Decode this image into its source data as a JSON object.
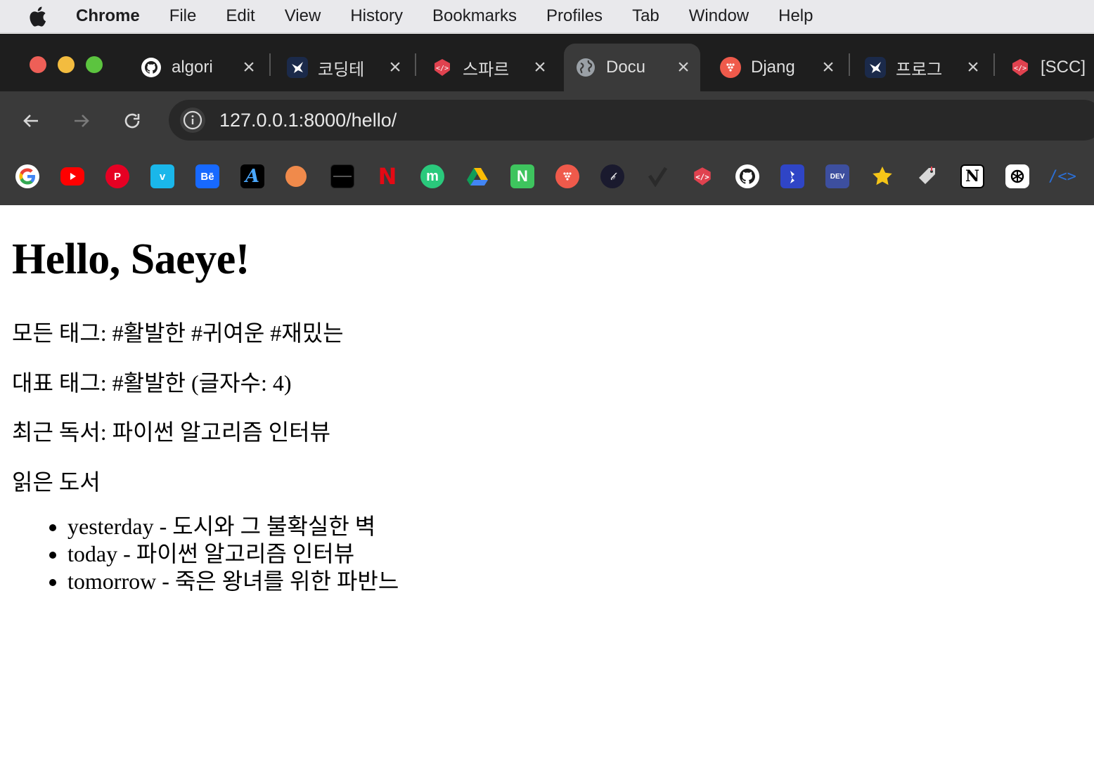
{
  "menubar": {
    "app": "Chrome",
    "items": [
      "File",
      "Edit",
      "View",
      "History",
      "Bookmarks",
      "Profiles",
      "Tab",
      "Window",
      "Help"
    ]
  },
  "tabs": [
    {
      "title": "algori",
      "icon": "github-icon"
    },
    {
      "title": "코딩테",
      "icon": "bird-icon"
    },
    {
      "title": "스파르",
      "icon": "sparta-icon"
    },
    {
      "title": "Docu",
      "icon": "globe-icon",
      "active": true
    },
    {
      "title": "Djang",
      "icon": "dots-icon"
    },
    {
      "title": "프로그",
      "icon": "bird-icon"
    },
    {
      "title": "[SCC]",
      "icon": "sparta-icon"
    }
  ],
  "toolbar": {
    "url": "127.0.0.1:8000/hello/"
  },
  "bookmarks": [
    "google-icon",
    "youtube-icon",
    "pinterest-icon",
    "vimeo-icon",
    "behance-icon",
    "typography-icon",
    "basketball-icon",
    "dark-icon",
    "netflix-icon",
    "m-icon",
    "drive-icon",
    "n-icon",
    "dots-icon",
    "pen-icon",
    "check-icon",
    "sparta-icon",
    "github-icon",
    "blue-bird-icon",
    "dev-icon",
    "star-icon",
    "tag-icon",
    "notion-icon",
    "openai-icon",
    "code-icon"
  ],
  "bookmark_labels": {
    "behance": "Bē",
    "dev": "DEV",
    "n": "N",
    "m": "m"
  },
  "page": {
    "heading": "Hello, Saeye!",
    "all_tags": "모든 태그: #활발한 #귀여운 #재밌는",
    "main_tag": "대표 태그: #활발한 (글자수: 4)",
    "recent_book": "최근 독서: 파이썬 알고리즘 인터뷰",
    "read_books_label": "읽은 도서",
    "books": [
      "yesterday - 도시와 그 불확실한 벽",
      "today - 파이썬 알고리즘 인터뷰",
      "tomorrow - 죽은 왕녀를 위한 파반느"
    ]
  }
}
